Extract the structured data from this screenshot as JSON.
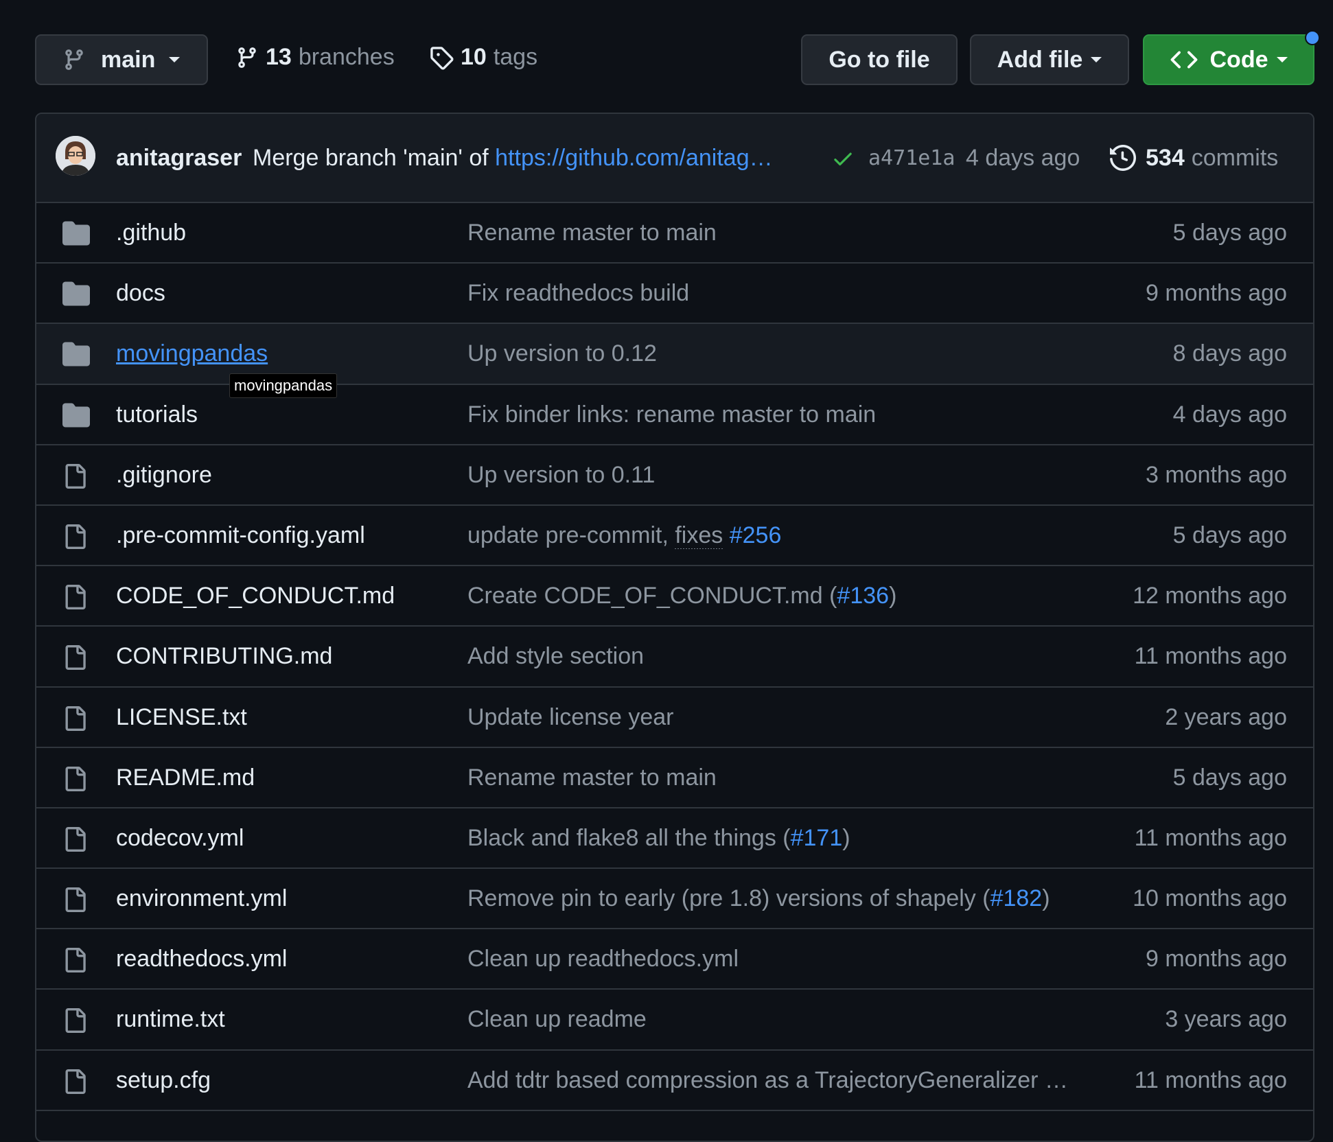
{
  "toolbar": {
    "branch": "main",
    "branches_count": "13",
    "branches_label": "branches",
    "tags_count": "10",
    "tags_label": "tags",
    "go_to_file": "Go to file",
    "add_file": "Add file",
    "code": "Code"
  },
  "commit": {
    "author": "anitagraser",
    "message": "Merge branch 'main' of ",
    "link": "https://github.com/anitag…",
    "sha": "a471e1a",
    "time": "4 days ago",
    "commits_count": "534",
    "commits_label": "commits"
  },
  "tooltip": "movingpandas",
  "files": [
    {
      "type": "folder",
      "name": ".github",
      "msg": "Rename master to main",
      "age": "5 days ago"
    },
    {
      "type": "folder",
      "name": "docs",
      "msg": "Fix readthedocs build",
      "age": "9 months ago"
    },
    {
      "type": "folder",
      "name": "movingpandas",
      "msg": "Up version to 0.12",
      "age": "8 days ago"
    },
    {
      "type": "folder",
      "name": "tutorials",
      "msg": "Fix binder links: rename master to main",
      "age": "4 days ago"
    },
    {
      "type": "file",
      "name": ".gitignore",
      "msg": "Up version to 0.11",
      "age": "3 months ago"
    },
    {
      "type": "file",
      "name": ".pre-commit-config.yaml",
      "msg": "update pre-commit, ",
      "msg2": "fixes",
      "msg3": " ",
      "pr": "#256",
      "age": "5 days ago"
    },
    {
      "type": "file",
      "name": "CODE_OF_CONDUCT.md",
      "msg": "Create CODE_OF_CONDUCT.md (",
      "pr": "#136",
      "msg_end": ")",
      "age": "12 months ago"
    },
    {
      "type": "file",
      "name": "CONTRIBUTING.md",
      "msg": "Add style section",
      "age": "11 months ago"
    },
    {
      "type": "file",
      "name": "LICENSE.txt",
      "msg": "Update license year",
      "age": "2 years ago"
    },
    {
      "type": "file",
      "name": "README.md",
      "msg": "Rename master to main",
      "age": "5 days ago"
    },
    {
      "type": "file",
      "name": "codecov.yml",
      "msg": "Black and flake8 all the things (",
      "pr": "#171",
      "msg_end": ")",
      "age": "11 months ago"
    },
    {
      "type": "file",
      "name": "environment.yml",
      "msg": "Remove pin to early (pre 1.8) versions of shapely (",
      "pr": "#182",
      "msg_end": ")",
      "age": "10 months ago"
    },
    {
      "type": "file",
      "name": "readthedocs.yml",
      "msg": "Clean up readthedocs.yml",
      "age": "9 months ago"
    },
    {
      "type": "file",
      "name": "runtime.txt",
      "msg": "Clean up readme",
      "age": "3 years ago"
    },
    {
      "type": "file",
      "name": "setup.cfg",
      "msg": "Add tdtr based compression as a TrajectoryGeneralizer …",
      "age": "11 months ago"
    }
  ],
  "colors": {
    "accent": "#4493f8",
    "code_button": "#238636",
    "check": "#3fb950"
  }
}
